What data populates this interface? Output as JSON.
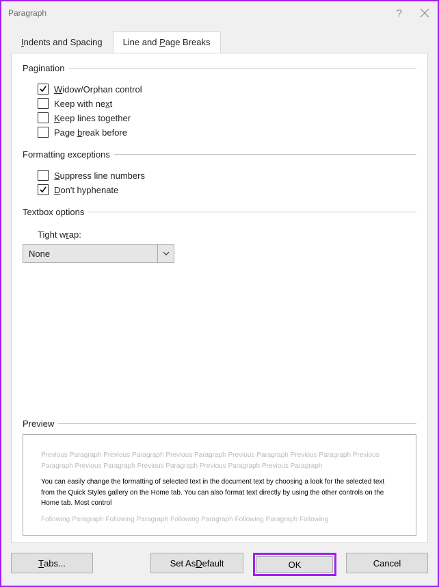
{
  "title": "Paragraph",
  "tabs": {
    "indents": {
      "pre": "",
      "u": "I",
      "post": "ndents and Spacing"
    },
    "breaks": {
      "pre": "Line and ",
      "u": "P",
      "post": "age Breaks"
    }
  },
  "groups": {
    "pagination": {
      "label": "Pagination",
      "items": [
        {
          "key": "widow",
          "checked": true,
          "pre": "",
          "u": "W",
          "post": "idow/Orphan control"
        },
        {
          "key": "keepnext",
          "checked": false,
          "pre": "Keep with ne",
          "u": "x",
          "post": "t"
        },
        {
          "key": "keeplines",
          "checked": false,
          "pre": "",
          "u": "K",
          "post": "eep lines together"
        },
        {
          "key": "pagebreak",
          "checked": false,
          "pre": "Page ",
          "u": "b",
          "post": "reak before"
        }
      ]
    },
    "formatting": {
      "label": "Formatting exceptions",
      "items": [
        {
          "key": "suppress",
          "checked": false,
          "pre": "",
          "u": "S",
          "post": "uppress line numbers"
        },
        {
          "key": "hyphen",
          "checked": true,
          "pre": "",
          "u": "D",
          "post": "on't hyphenate"
        }
      ]
    },
    "textbox": {
      "label": "Textbox options",
      "tightwrap": {
        "pre": "Tight w",
        "u": "r",
        "post": "ap:"
      },
      "value": "None"
    },
    "preview": {
      "label": "Preview",
      "previous": "Previous Paragraph Previous Paragraph Previous Paragraph Previous Paragraph Previous Paragraph Previous Paragraph Previous Paragraph Previous Paragraph Previous Paragraph Previous Paragraph",
      "sample": "You can easily change the formatting of selected text in the document text by choosing a look for the selected text from the Quick Styles gallery on the Home tab. You can also format text directly by using the other controls on the Home tab. Most control",
      "following": "Following Paragraph Following Paragraph Following Paragraph Following Paragraph Following"
    }
  },
  "buttons": {
    "tabs": {
      "u": "T",
      "post": "abs..."
    },
    "default": {
      "pre": "Set As ",
      "u": "D",
      "post": "efault"
    },
    "ok": "OK",
    "cancel": "Cancel"
  }
}
